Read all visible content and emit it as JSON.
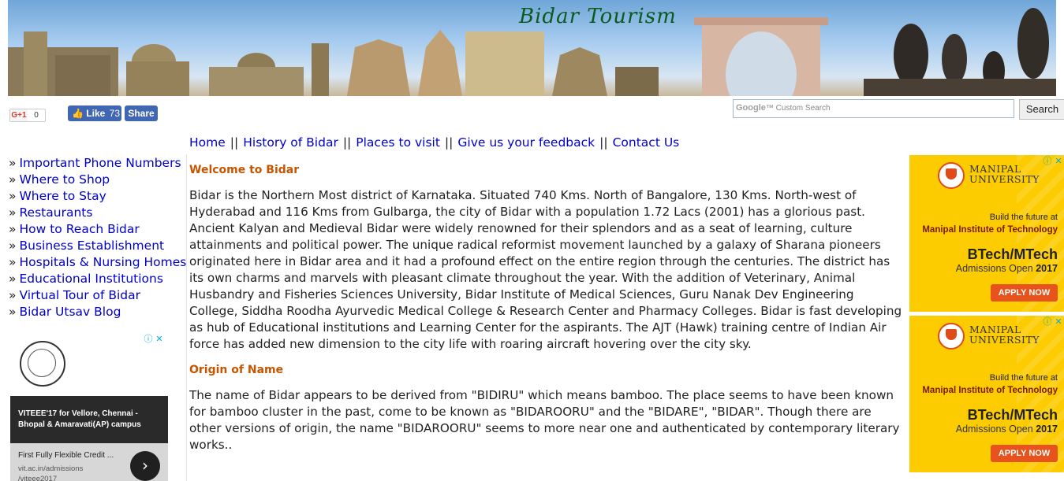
{
  "banner": {
    "title": "Bidar Tourism"
  },
  "social": {
    "gplus_label": "G+1",
    "gplus_count": "0",
    "fb_like": "Like",
    "fb_like_count": "73",
    "fb_share": "Share"
  },
  "search": {
    "google_brand": "Google",
    "placeholder": "Custom Search",
    "button": "Search"
  },
  "nav": [
    "Home",
    "History of Bidar",
    "Places to visit",
    "Give us your feedback",
    "Contact Us"
  ],
  "nav_separator": "||",
  "sidebar": {
    "bullet": "»",
    "items": [
      "Important Phone Numbers",
      "Where to Shop",
      "Where to Stay",
      "Restaurants",
      "How to Reach Bidar",
      "Business Establishment",
      "Hospitals & Nursing Homes",
      "Educational Institutions",
      "Virtual Tour of Bidar",
      "Bidar Utsav Blog"
    ]
  },
  "left_ad": {
    "headline": "VITEEE'17 for Vellore, Chennai - Bhopal & Amaravati(AP) campus",
    "subline": "First Fully Flexible Credit ...",
    "url": "vit.ac.in/admissions",
    "url2": "/viteee2017",
    "go_glyph": "›",
    "info_icon": "ⓘ",
    "close_icon": "✕"
  },
  "main": {
    "welcome_heading": "Welcome to Bidar",
    "welcome_text": "Bidar is the Northern Most district of Karnataka. Situated 740 Kms. North of Bangalore, 130 Kms. North-west of Hyderabad and 116 Kms from Gulbarga, the city of Bidar with a population 1.72 Lacs (2001) has a glorious past. Ancient Kalyan and Medieval Bidar were widely renowned for their splendors and as a seat of learning, culture attainments and political power. The unique radical reformist movement launched by a galaxy of Sharana pioneers originated here in Bidar area and it had a profound effect on the entire region through the centuries. The district has its own charms and marvels with pleasant climate throughout the year. With the addition of Veterinary, Animal Husbandry and Fisheries Sciences University, Bidar Institute of Medical Sciences, Guru Nanak Dev Engineering College, Siddha Roodha Ayurvedic Medical College & Research Center and Pharmacy Colleges. Bidar is fast developing as hub of Educational institutions and Learning Center for the aspirants. The AJT (Hawk) training centre of Indian Air force has added new dimension to the city life with roaring aircraft hovering over the city sky.",
    "origin_heading": "Origin of Name",
    "origin_text": "The name of Bidar appears to be derived from \"BIDIRU\" which means bamboo. The place seems to have been known for bamboo cluster in the past, come to be known as \"BIDAROORU\" and the \"BIDARE\", \"BIDAR\". Though there are other versions of origin, the name \"BIDAROORU\" seems to more near one and authenticated by contemporary literary works.."
  },
  "right_ads": [
    {
      "uni_line1": "MANIPAL",
      "uni_line2": "UNIVERSITY",
      "build": "Build the future at",
      "institute": "Manipal Institute of Technology",
      "program": "BTech/MTech",
      "admissions": "Admissions Open",
      "year": "2017",
      "cta": "APPLY NOW"
    },
    {
      "uni_line1": "MANIPAL",
      "uni_line2": "UNIVERSITY",
      "build": "Build the future at",
      "institute": "Manipal Institute of Technology",
      "program": "BTech/MTech",
      "admissions": "Admissions Open",
      "year": "2017",
      "cta": "APPLY NOW"
    }
  ],
  "colors": {
    "link": "#0000cc",
    "heading": "#c65400",
    "ad_yellow": "#fccb00",
    "fb_blue": "#4267b2",
    "apply_orange": "#e8521c"
  }
}
